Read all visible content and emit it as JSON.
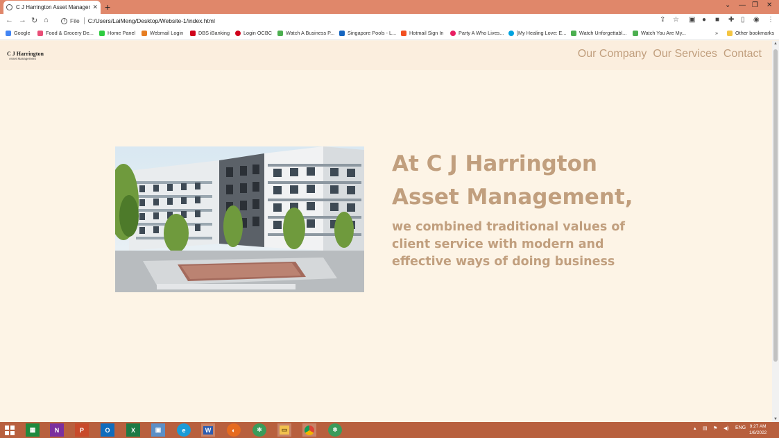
{
  "browser": {
    "tab_title": "C J Harrington Asset Management",
    "new_tab": "+",
    "address_scheme": "File",
    "url": "C:/Users/LaiMeng/Desktop/Website-1/index.html"
  },
  "bookmarks": [
    {
      "label": "Google",
      "color": "#4285f4"
    },
    {
      "label": "Food & Grocery De...",
      "color": "#e94e77"
    },
    {
      "label": "Home Panel",
      "color": "#2ecc40"
    },
    {
      "label": "Webmail Login",
      "color": "#e67e22"
    },
    {
      "label": "DBS iBanking",
      "color": "#d0021b"
    },
    {
      "label": "Login OCBC",
      "color": "#d0021b"
    },
    {
      "label": "Watch A Business P...",
      "color": "#4caf50"
    },
    {
      "label": "Singapore Pools - L...",
      "color": "#1565c0"
    },
    {
      "label": "Hotmail Sign In",
      "color": "#f25022"
    },
    {
      "label": "Party A Who Lives...",
      "color": "#e91e63"
    },
    {
      "label": "[My Healing Love: E...",
      "color": "#00a3e0"
    },
    {
      "label": "Watch Unforgettabl...",
      "color": "#4caf50"
    },
    {
      "label": "Watch You Are My...",
      "color": "#4caf50"
    }
  ],
  "other_bookmarks": "Other bookmarks",
  "site": {
    "logo_name": "C J Harrington",
    "logo_tagline": "Asset Management",
    "nav": [
      "Our Company",
      "Our Services",
      "Contact"
    ],
    "headline_line1": "At C J Harrington",
    "headline_line2": "Asset Management,",
    "subtext": "we combined traditional values of client service with modern and effective ways of doing business",
    "accent_color": "#c19f7e",
    "background_color": "#fdf4e6"
  },
  "taskbar": {
    "language": "ENG",
    "time": "9:27 AM",
    "date": "1/6/2022",
    "apps": [
      "start-icon",
      "sheets-icon",
      "onenote-icon",
      "powerpoint-icon",
      "outlook-icon",
      "excel-icon",
      "control-panel-icon",
      "edge-icon",
      "word-icon",
      "firefox-icon",
      "atom-icon",
      "file-explorer-icon",
      "chrome-icon",
      "atom-icon"
    ]
  }
}
